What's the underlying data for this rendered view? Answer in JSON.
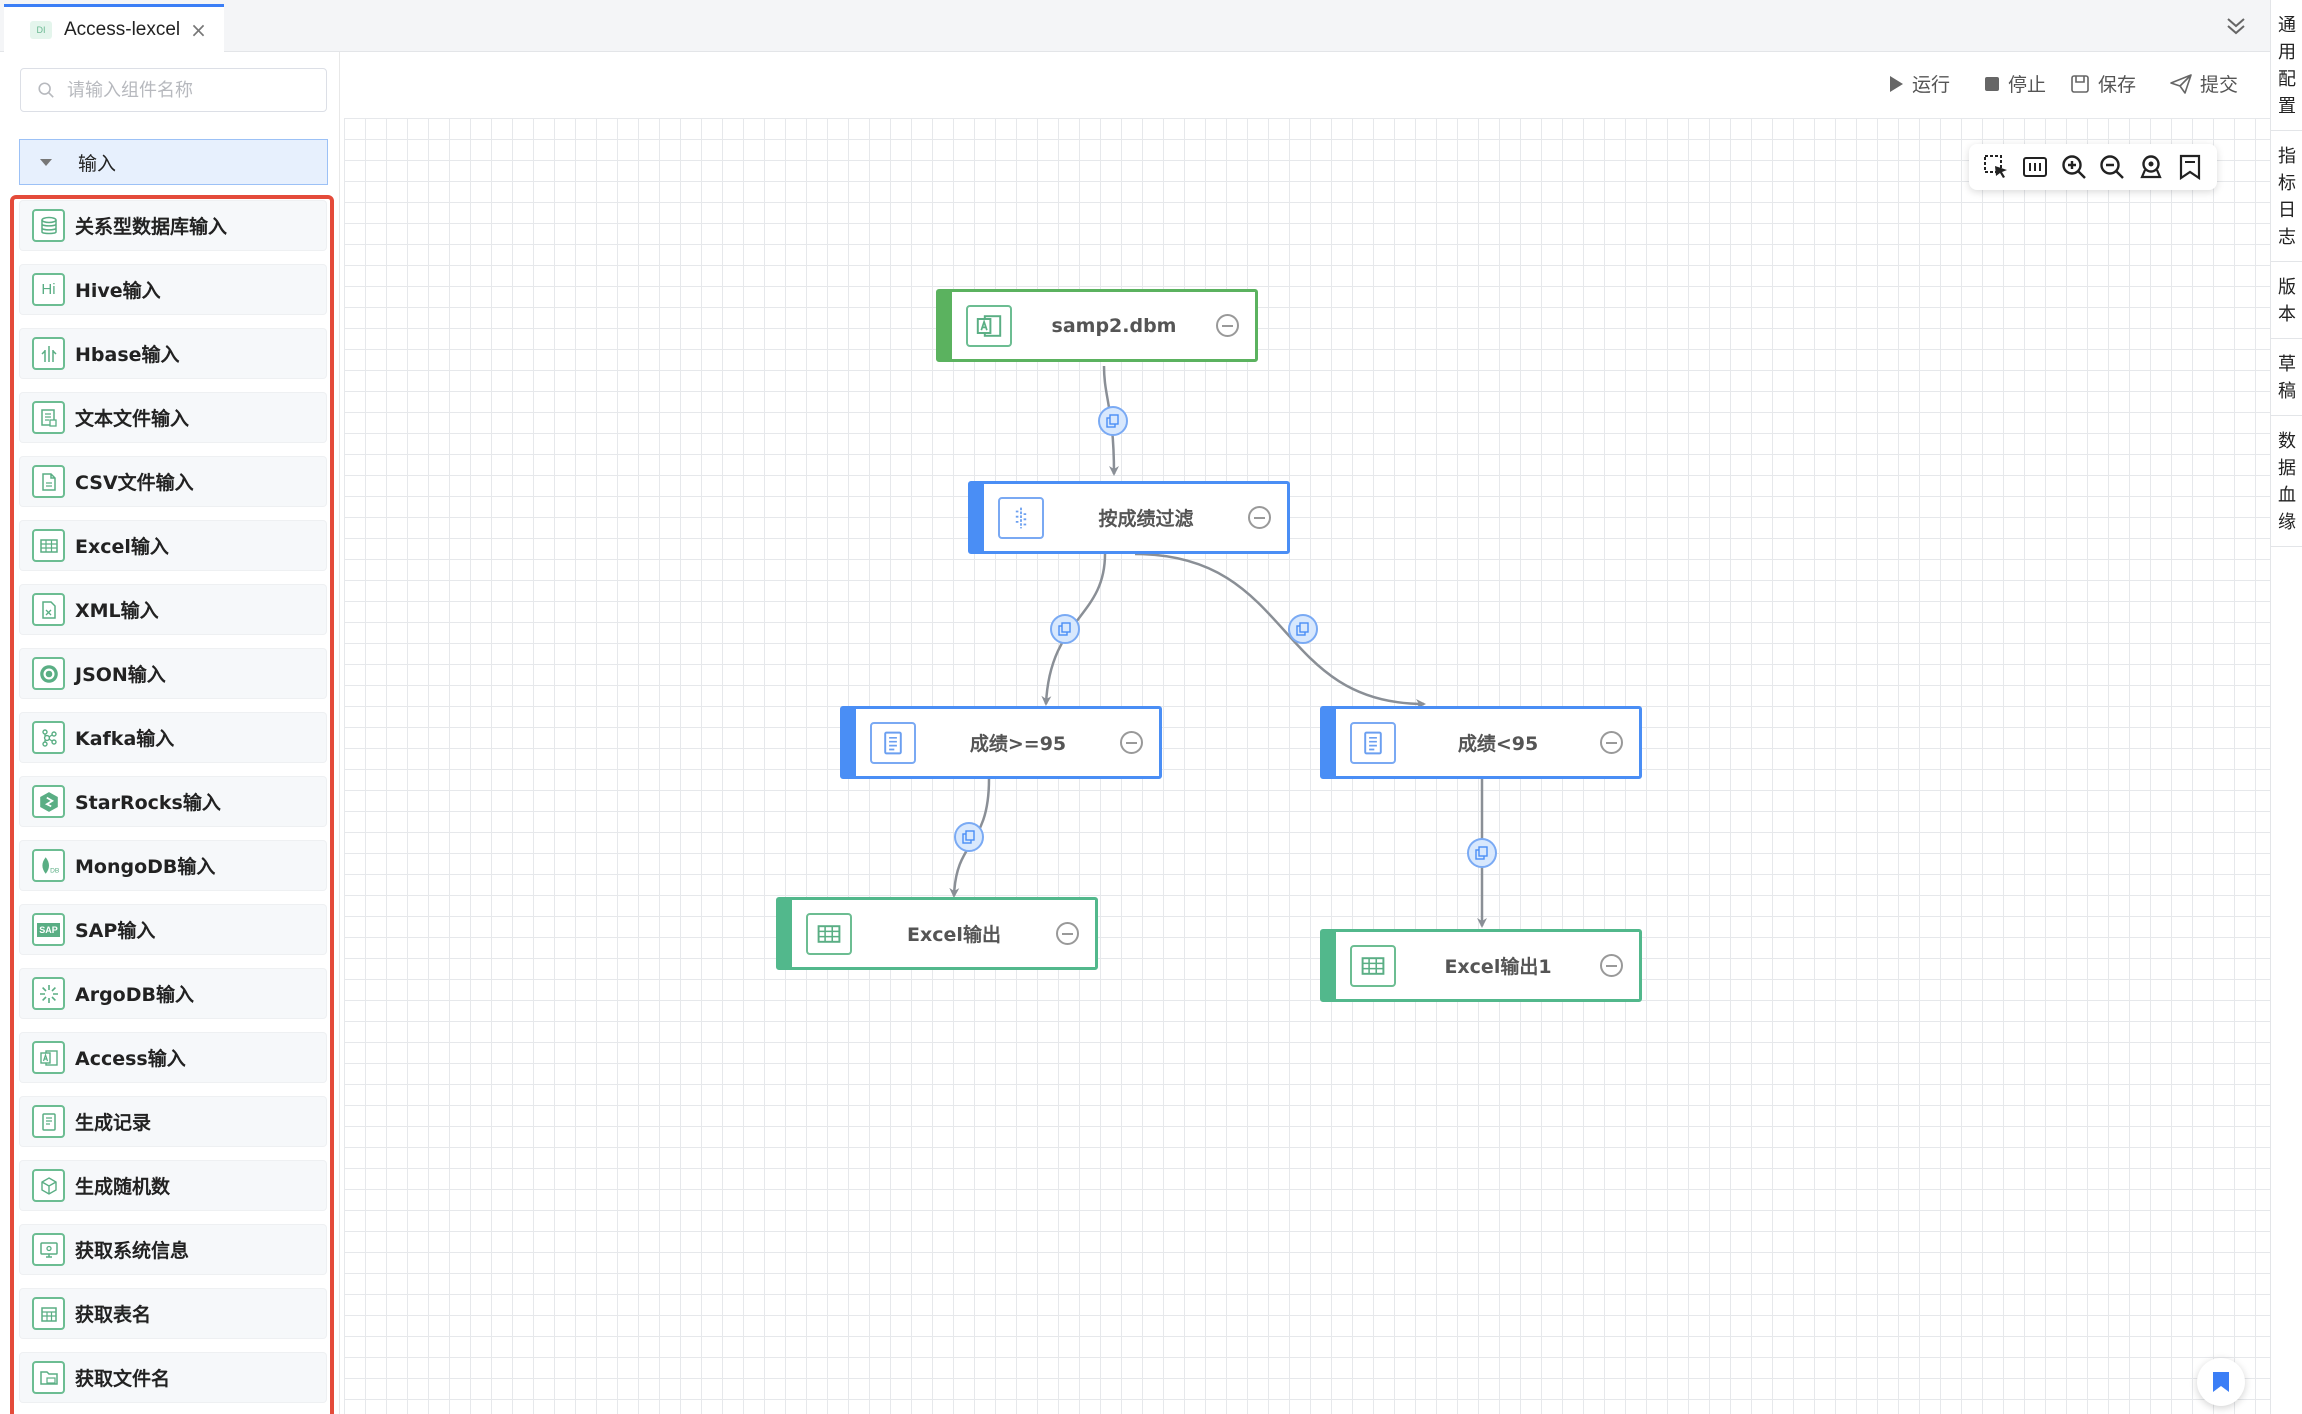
{
  "tab": {
    "label": "Access-lexcel",
    "icon_text": "DI",
    "icon": "data-integration-icon"
  },
  "sidebar": {
    "search_placeholder": "请输入组件名称",
    "group_label": "输入",
    "items": [
      {
        "label": "关系型数据库输入",
        "icon": "database-icon"
      },
      {
        "label": "Hive输入",
        "icon": "hive-icon",
        "icon_text": "Hi"
      },
      {
        "label": "Hbase输入",
        "icon": "hbase-icon"
      },
      {
        "label": "文本文件输入",
        "icon": "text-file-icon"
      },
      {
        "label": "CSV文件输入",
        "icon": "csv-file-icon"
      },
      {
        "label": "Excel输入",
        "icon": "excel-icon"
      },
      {
        "label": "XML输入",
        "icon": "xml-file-icon"
      },
      {
        "label": "JSON输入",
        "icon": "json-icon"
      },
      {
        "label": "Kafka输入",
        "icon": "kafka-icon"
      },
      {
        "label": "StarRocks输入",
        "icon": "starrocks-icon"
      },
      {
        "label": "MongoDB输入",
        "icon": "mongodb-icon"
      },
      {
        "label": "SAP输入",
        "icon": "sap-icon",
        "icon_text": "SAP"
      },
      {
        "label": "ArgoDB输入",
        "icon": "argodb-icon"
      },
      {
        "label": "Access输入",
        "icon": "access-icon"
      },
      {
        "label": "生成记录",
        "icon": "generate-record-icon"
      },
      {
        "label": "生成随机数",
        "icon": "random-number-icon"
      },
      {
        "label": "获取系统信息",
        "icon": "system-info-icon"
      },
      {
        "label": "获取表名",
        "icon": "table-name-icon"
      },
      {
        "label": "获取文件名",
        "icon": "file-name-icon"
      }
    ]
  },
  "toolbar": {
    "run": "运行",
    "stop": "停止",
    "save": "保存",
    "submit": "提交"
  },
  "right_panel": [
    {
      "label": "通用配置",
      "chars": [
        "通",
        "用",
        "配",
        "置"
      ]
    },
    {
      "label": "指标日志",
      "chars": [
        "指",
        "标",
        "日",
        "志"
      ]
    },
    {
      "label": "版本",
      "chars": [
        "版",
        "本"
      ]
    },
    {
      "label": "草稿",
      "chars": [
        "草",
        "稿"
      ]
    },
    {
      "label": "数据血缘",
      "chars": [
        "数",
        "据",
        "血",
        "缘"
      ]
    }
  ],
  "canvas": {
    "zoom_tools": [
      "box-select-icon",
      "fit-view-icon",
      "zoom-in-icon",
      "zoom-out-icon",
      "locate-icon",
      "minimap-icon"
    ],
    "nodes": [
      {
        "id": "n1",
        "label": "samp2.dbm",
        "icon": "access-icon",
        "color": "#5bb25f"
      },
      {
        "id": "n2",
        "label": "按成绩过滤",
        "icon": "filter-icon",
        "color": "#4a8ef5"
      },
      {
        "id": "n3",
        "label": "成绩>=95",
        "icon": "record-icon",
        "color": "#4a8ef5"
      },
      {
        "id": "n4",
        "label": "成绩<95",
        "icon": "record-icon",
        "color": "#4a8ef5"
      },
      {
        "id": "n5",
        "label": "Excel输出",
        "icon": "excel-icon",
        "color": "#52b88c"
      },
      {
        "id": "n6",
        "label": "Excel输出1",
        "icon": "excel-icon",
        "color": "#52b88c"
      }
    ],
    "edges": [
      {
        "from": "n1",
        "to": "n2"
      },
      {
        "from": "n2",
        "to": "n3"
      },
      {
        "from": "n2",
        "to": "n4"
      },
      {
        "from": "n3",
        "to": "n5"
      },
      {
        "from": "n4",
        "to": "n6"
      }
    ]
  }
}
